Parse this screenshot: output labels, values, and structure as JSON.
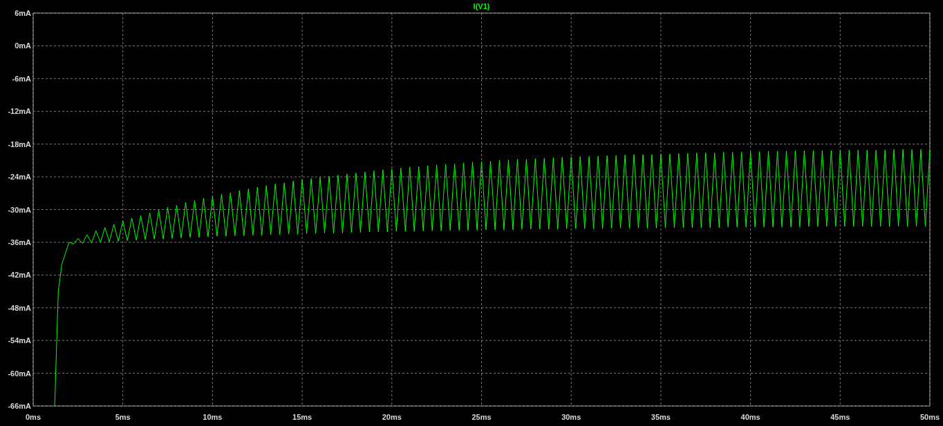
{
  "chart_data": {
    "type": "line",
    "grid": true,
    "xlim": [
      0,
      50
    ],
    "ylim": [
      -66,
      6
    ],
    "xticks": [
      {
        "value": 0,
        "label": "0ms"
      },
      {
        "value": 5,
        "label": "5ms"
      },
      {
        "value": 10,
        "label": "10ms"
      },
      {
        "value": 15,
        "label": "15ms"
      },
      {
        "value": 20,
        "label": "20ms"
      },
      {
        "value": 25,
        "label": "25ms"
      },
      {
        "value": 30,
        "label": "30ms"
      },
      {
        "value": 35,
        "label": "35ms"
      },
      {
        "value": 40,
        "label": "40ms"
      },
      {
        "value": 45,
        "label": "45ms"
      },
      {
        "value": 50,
        "label": "50ms"
      }
    ],
    "yticks": [
      {
        "value": 6,
        "label": "6mA"
      },
      {
        "value": 0,
        "label": "0mA"
      },
      {
        "value": -6,
        "label": "-6mA"
      },
      {
        "value": -12,
        "label": "-12mA"
      },
      {
        "value": -18,
        "label": "-18mA"
      },
      {
        "value": -24,
        "label": "-24mA"
      },
      {
        "value": -30,
        "label": "-30mA"
      },
      {
        "value": -36,
        "label": "-36mA"
      },
      {
        "value": -42,
        "label": "-42mA"
      },
      {
        "value": -48,
        "label": "-48mA"
      },
      {
        "value": -54,
        "label": "-54mA"
      },
      {
        "value": -60,
        "label": "-60mA"
      },
      {
        "value": -66,
        "label": "-66mA"
      }
    ],
    "x": [
      1.2,
      1.4,
      1.6,
      1.8,
      2,
      2.25,
      2.5,
      2.75,
      3,
      3.25,
      3.5,
      3.75,
      4,
      4.25,
      4.5,
      4.75,
      5,
      5.25,
      5.5,
      5.75,
      6,
      6.25,
      6.5,
      6.75,
      7,
      7.25,
      7.5,
      7.75,
      8,
      8.25,
      8.5,
      8.75,
      9,
      9.25,
      9.5,
      9.75,
      10,
      10.25,
      10.5,
      10.75,
      11,
      11.25,
      11.5,
      11.75,
      12,
      12.25,
      12.5,
      12.75,
      13,
      13.25,
      13.5,
      13.75,
      14,
      14.25,
      14.5,
      14.75,
      15,
      15.25,
      15.5,
      15.75,
      16,
      16.25,
      16.5,
      16.75,
      17,
      17.25,
      17.5,
      17.75,
      18,
      18.25,
      18.5,
      18.75,
      19,
      19.25,
      19.5,
      19.75,
      20,
      20.25,
      20.5,
      20.75,
      21,
      21.25,
      21.5,
      21.75,
      22,
      22.25,
      22.5,
      22.75,
      23,
      23.25,
      23.5,
      23.75,
      24,
      24.25,
      24.5,
      24.75,
      25,
      25.25,
      25.5,
      25.75,
      26,
      26.25,
      26.5,
      26.75,
      27,
      27.25,
      27.5,
      27.75,
      28,
      28.25,
      28.5,
      28.75,
      29,
      29.25,
      29.5,
      29.75,
      30,
      30.25,
      30.5,
      30.75,
      31,
      31.25,
      31.5,
      31.75,
      32,
      32.25,
      32.5,
      32.75,
      33,
      33.25,
      33.5,
      33.75,
      34,
      34.25,
      34.5,
      34.75,
      35,
      35.25,
      35.5,
      35.75,
      36,
      36.25,
      36.5,
      36.75,
      37,
      37.25,
      37.5,
      37.75,
      38,
      38.25,
      38.5,
      38.75,
      39,
      39.25,
      39.5,
      39.75,
      40,
      40.25,
      40.5,
      40.75,
      41,
      41.25,
      41.5,
      41.75,
      42,
      42.25,
      42.5,
      42.75,
      43,
      43.25,
      43.5,
      43.75,
      44,
      44.25,
      44.5,
      44.75,
      45,
      45.25,
      45.5,
      45.75,
      46,
      46.25,
      46.5,
      46.75,
      47,
      47.25,
      47.5,
      47.75,
      48,
      48.25,
      48.5,
      48.75,
      49,
      49.25,
      49.5,
      49.75,
      50
    ],
    "series": [
      {
        "name": "I(V1)",
        "color": "#00ff00",
        "values": [
          -66,
          -45,
          -40,
          -38,
          -36.0,
          -36.3,
          -35.3,
          -36.2,
          -34.6,
          -36.1,
          -33.9,
          -36.0,
          -33.3,
          -35.9,
          -32.7,
          -35.8,
          -32.1,
          -35.7,
          -31.6,
          -35.6,
          -31.1,
          -35.5,
          -30.6,
          -35.4,
          -30.1,
          -35.4,
          -29.6,
          -35.3,
          -29.2,
          -35.2,
          -28.7,
          -35.1,
          -28.3,
          -35.1,
          -27.9,
          -35.0,
          -27.6,
          -34.9,
          -27.2,
          -34.9,
          -26.9,
          -34.8,
          -26.5,
          -34.8,
          -26.2,
          -34.7,
          -25.9,
          -34.7,
          -25.6,
          -34.6,
          -25.3,
          -34.6,
          -25.1,
          -34.5,
          -24.8,
          -34.5,
          -24.5,
          -34.4,
          -24.3,
          -34.4,
          -24.1,
          -34.3,
          -23.9,
          -34.3,
          -23.7,
          -34.3,
          -23.5,
          -34.2,
          -23.3,
          -34.2,
          -23.1,
          -34.1,
          -22.9,
          -34.1,
          -22.7,
          -34.1,
          -22.6,
          -34.0,
          -22.4,
          -34.0,
          -22.2,
          -34.0,
          -22.1,
          -33.9,
          -22.0,
          -33.9,
          -21.8,
          -33.9,
          -21.7,
          -33.8,
          -21.6,
          -33.8,
          -21.5,
          -33.8,
          -21.3,
          -33.8,
          -21.2,
          -33.7,
          -21.1,
          -33.7,
          -21.0,
          -33.7,
          -20.9,
          -33.7,
          -20.8,
          -33.6,
          -20.8,
          -33.6,
          -20.7,
          -33.6,
          -20.6,
          -33.6,
          -20.5,
          -33.6,
          -20.4,
          -33.5,
          -20.4,
          -33.5,
          -20.3,
          -33.5,
          -20.3,
          -33.5,
          -20.2,
          -33.5,
          -20.1,
          -33.4,
          -20.1,
          -33.4,
          -20.0,
          -33.4,
          -19.9,
          -33.4,
          -19.9,
          -33.4,
          -19.9,
          -33.4,
          -19.8,
          -33.3,
          -19.8,
          -33.3,
          -19.7,
          -33.3,
          -19.7,
          -33.3,
          -19.6,
          -33.3,
          -19.6,
          -33.3,
          -19.6,
          -33.3,
          -19.5,
          -33.2,
          -19.5,
          -33.2,
          -19.5,
          -33.2,
          -19.4,
          -33.2,
          -19.4,
          -33.2,
          -19.3,
          -33.2,
          -19.3,
          -33.2,
          -19.3,
          -33.2,
          -19.2,
          -33.2,
          -19.2,
          -33.1,
          -19.2,
          -33.1,
          -19.2,
          -33.1,
          -19.2,
          -33.1,
          -19.1,
          -33.1,
          -19.1,
          -33.1,
          -19.1,
          -33.1,
          -19.1,
          -33.1,
          -19.1,
          -33.1,
          -19.1,
          -33.1,
          -19.0,
          -33.1,
          -19.0,
          -33.1,
          -19.0,
          -33.1,
          -19.0,
          -33.1,
          -19.0
        ]
      }
    ]
  }
}
